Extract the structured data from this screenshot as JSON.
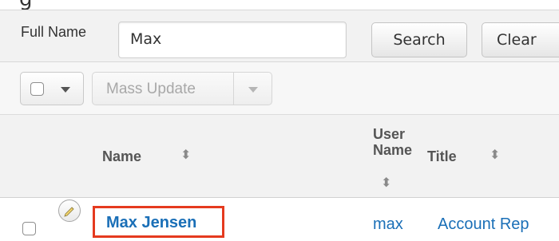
{
  "header_cropped_text": "g",
  "search": {
    "label": "Full Name",
    "input_value": "Max",
    "search_button": "Search",
    "clear_button": "Clear"
  },
  "actions": {
    "mass_update": "Mass Update"
  },
  "table": {
    "columns": [
      {
        "key": "name",
        "label": "Name",
        "sortable": true
      },
      {
        "key": "user_name",
        "label": "User Name",
        "label_lines": [
          "User",
          "Name"
        ],
        "sortable": true
      },
      {
        "key": "title",
        "label": "Title",
        "sortable": true
      }
    ],
    "rows": [
      {
        "name": "Max Jensen",
        "user_name": "max",
        "title": "Account Rep",
        "highlighted": true
      }
    ]
  },
  "colors": {
    "link": "#1a6fb7",
    "highlight_border": "#e53a1f",
    "panel_bg": "#f2f2f2"
  },
  "icons": {
    "row_edit": "pencil-icon",
    "sort": "sort-arrows-icon",
    "dropdown": "caret-down-icon"
  }
}
